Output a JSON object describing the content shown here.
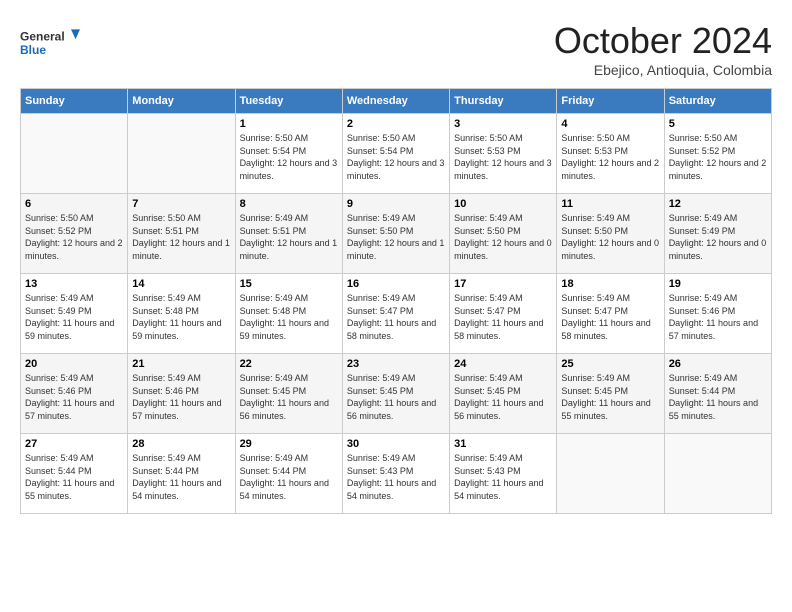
{
  "header": {
    "logo_general": "General",
    "logo_blue": "Blue",
    "month_title": "October 2024",
    "subtitle": "Ebejico, Antioquia, Colombia"
  },
  "days_of_week": [
    "Sunday",
    "Monday",
    "Tuesday",
    "Wednesday",
    "Thursday",
    "Friday",
    "Saturday"
  ],
  "weeks": [
    {
      "days": [
        {
          "number": "",
          "info": ""
        },
        {
          "number": "",
          "info": ""
        },
        {
          "number": "1",
          "info": "Sunrise: 5:50 AM\nSunset: 5:54 PM\nDaylight: 12 hours and 3 minutes."
        },
        {
          "number": "2",
          "info": "Sunrise: 5:50 AM\nSunset: 5:54 PM\nDaylight: 12 hours and 3 minutes."
        },
        {
          "number": "3",
          "info": "Sunrise: 5:50 AM\nSunset: 5:53 PM\nDaylight: 12 hours and 3 minutes."
        },
        {
          "number": "4",
          "info": "Sunrise: 5:50 AM\nSunset: 5:53 PM\nDaylight: 12 hours and 2 minutes."
        },
        {
          "number": "5",
          "info": "Sunrise: 5:50 AM\nSunset: 5:52 PM\nDaylight: 12 hours and 2 minutes."
        }
      ]
    },
    {
      "days": [
        {
          "number": "6",
          "info": "Sunrise: 5:50 AM\nSunset: 5:52 PM\nDaylight: 12 hours and 2 minutes."
        },
        {
          "number": "7",
          "info": "Sunrise: 5:50 AM\nSunset: 5:51 PM\nDaylight: 12 hours and 1 minute."
        },
        {
          "number": "8",
          "info": "Sunrise: 5:49 AM\nSunset: 5:51 PM\nDaylight: 12 hours and 1 minute."
        },
        {
          "number": "9",
          "info": "Sunrise: 5:49 AM\nSunset: 5:50 PM\nDaylight: 12 hours and 1 minute."
        },
        {
          "number": "10",
          "info": "Sunrise: 5:49 AM\nSunset: 5:50 PM\nDaylight: 12 hours and 0 minutes."
        },
        {
          "number": "11",
          "info": "Sunrise: 5:49 AM\nSunset: 5:50 PM\nDaylight: 12 hours and 0 minutes."
        },
        {
          "number": "12",
          "info": "Sunrise: 5:49 AM\nSunset: 5:49 PM\nDaylight: 12 hours and 0 minutes."
        }
      ]
    },
    {
      "days": [
        {
          "number": "13",
          "info": "Sunrise: 5:49 AM\nSunset: 5:49 PM\nDaylight: 11 hours and 59 minutes."
        },
        {
          "number": "14",
          "info": "Sunrise: 5:49 AM\nSunset: 5:48 PM\nDaylight: 11 hours and 59 minutes."
        },
        {
          "number": "15",
          "info": "Sunrise: 5:49 AM\nSunset: 5:48 PM\nDaylight: 11 hours and 59 minutes."
        },
        {
          "number": "16",
          "info": "Sunrise: 5:49 AM\nSunset: 5:47 PM\nDaylight: 11 hours and 58 minutes."
        },
        {
          "number": "17",
          "info": "Sunrise: 5:49 AM\nSunset: 5:47 PM\nDaylight: 11 hours and 58 minutes."
        },
        {
          "number": "18",
          "info": "Sunrise: 5:49 AM\nSunset: 5:47 PM\nDaylight: 11 hours and 58 minutes."
        },
        {
          "number": "19",
          "info": "Sunrise: 5:49 AM\nSunset: 5:46 PM\nDaylight: 11 hours and 57 minutes."
        }
      ]
    },
    {
      "days": [
        {
          "number": "20",
          "info": "Sunrise: 5:49 AM\nSunset: 5:46 PM\nDaylight: 11 hours and 57 minutes."
        },
        {
          "number": "21",
          "info": "Sunrise: 5:49 AM\nSunset: 5:46 PM\nDaylight: 11 hours and 57 minutes."
        },
        {
          "number": "22",
          "info": "Sunrise: 5:49 AM\nSunset: 5:45 PM\nDaylight: 11 hours and 56 minutes."
        },
        {
          "number": "23",
          "info": "Sunrise: 5:49 AM\nSunset: 5:45 PM\nDaylight: 11 hours and 56 minutes."
        },
        {
          "number": "24",
          "info": "Sunrise: 5:49 AM\nSunset: 5:45 PM\nDaylight: 11 hours and 56 minutes."
        },
        {
          "number": "25",
          "info": "Sunrise: 5:49 AM\nSunset: 5:45 PM\nDaylight: 11 hours and 55 minutes."
        },
        {
          "number": "26",
          "info": "Sunrise: 5:49 AM\nSunset: 5:44 PM\nDaylight: 11 hours and 55 minutes."
        }
      ]
    },
    {
      "days": [
        {
          "number": "27",
          "info": "Sunrise: 5:49 AM\nSunset: 5:44 PM\nDaylight: 11 hours and 55 minutes."
        },
        {
          "number": "28",
          "info": "Sunrise: 5:49 AM\nSunset: 5:44 PM\nDaylight: 11 hours and 54 minutes."
        },
        {
          "number": "29",
          "info": "Sunrise: 5:49 AM\nSunset: 5:44 PM\nDaylight: 11 hours and 54 minutes."
        },
        {
          "number": "30",
          "info": "Sunrise: 5:49 AM\nSunset: 5:43 PM\nDaylight: 11 hours and 54 minutes."
        },
        {
          "number": "31",
          "info": "Sunrise: 5:49 AM\nSunset: 5:43 PM\nDaylight: 11 hours and 54 minutes."
        },
        {
          "number": "",
          "info": ""
        },
        {
          "number": "",
          "info": ""
        }
      ]
    }
  ]
}
